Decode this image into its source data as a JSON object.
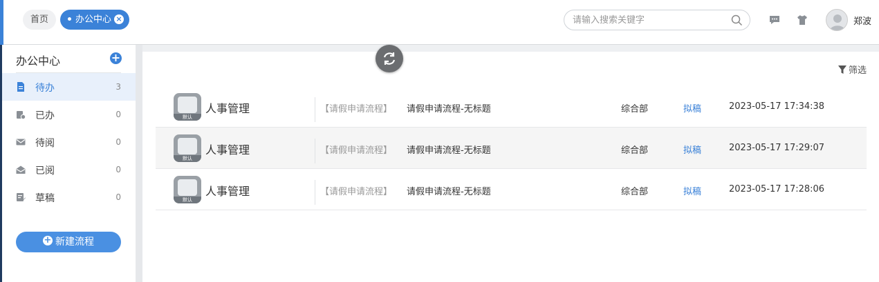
{
  "header": {
    "tabs": [
      {
        "label": "首页"
      },
      {
        "label": "办公中心"
      }
    ],
    "search": {
      "placeholder": "请输入搜索关键字"
    },
    "user": {
      "name": "郑波"
    },
    "accent": "#3b82d8"
  },
  "sidebar": {
    "title": "办公中心",
    "items": [
      {
        "label": "待办",
        "count": "3",
        "icon": "document-icon"
      },
      {
        "label": "已办",
        "count": "0",
        "icon": "done-icon"
      },
      {
        "label": "待阅",
        "count": "0",
        "icon": "envelope-icon"
      },
      {
        "label": "已阅",
        "count": "0",
        "icon": "open-envelope-icon"
      },
      {
        "label": "草稿",
        "count": "0",
        "icon": "edit-icon"
      }
    ],
    "new_button": "新建流程"
  },
  "main": {
    "filter_label": "筛选",
    "rows": [
      {
        "app_tag": "默认",
        "app": "人事管理",
        "type": "【请假申请流程】",
        "title": "请假申请流程-无标题",
        "dept": "综合部",
        "status": "拟稿",
        "time": "2023-05-17 17:34:38"
      },
      {
        "app_tag": "默认",
        "app": "人事管理",
        "type": "【请假申请流程】",
        "title": "请假申请流程-无标题",
        "dept": "综合部",
        "status": "拟稿",
        "time": "2023-05-17 17:29:07"
      },
      {
        "app_tag": "默认",
        "app": "人事管理",
        "type": "【请假申请流程】",
        "title": "请假申请流程-无标题",
        "dept": "综合部",
        "status": "拟稿",
        "time": "2023-05-17 17:28:06"
      }
    ]
  }
}
